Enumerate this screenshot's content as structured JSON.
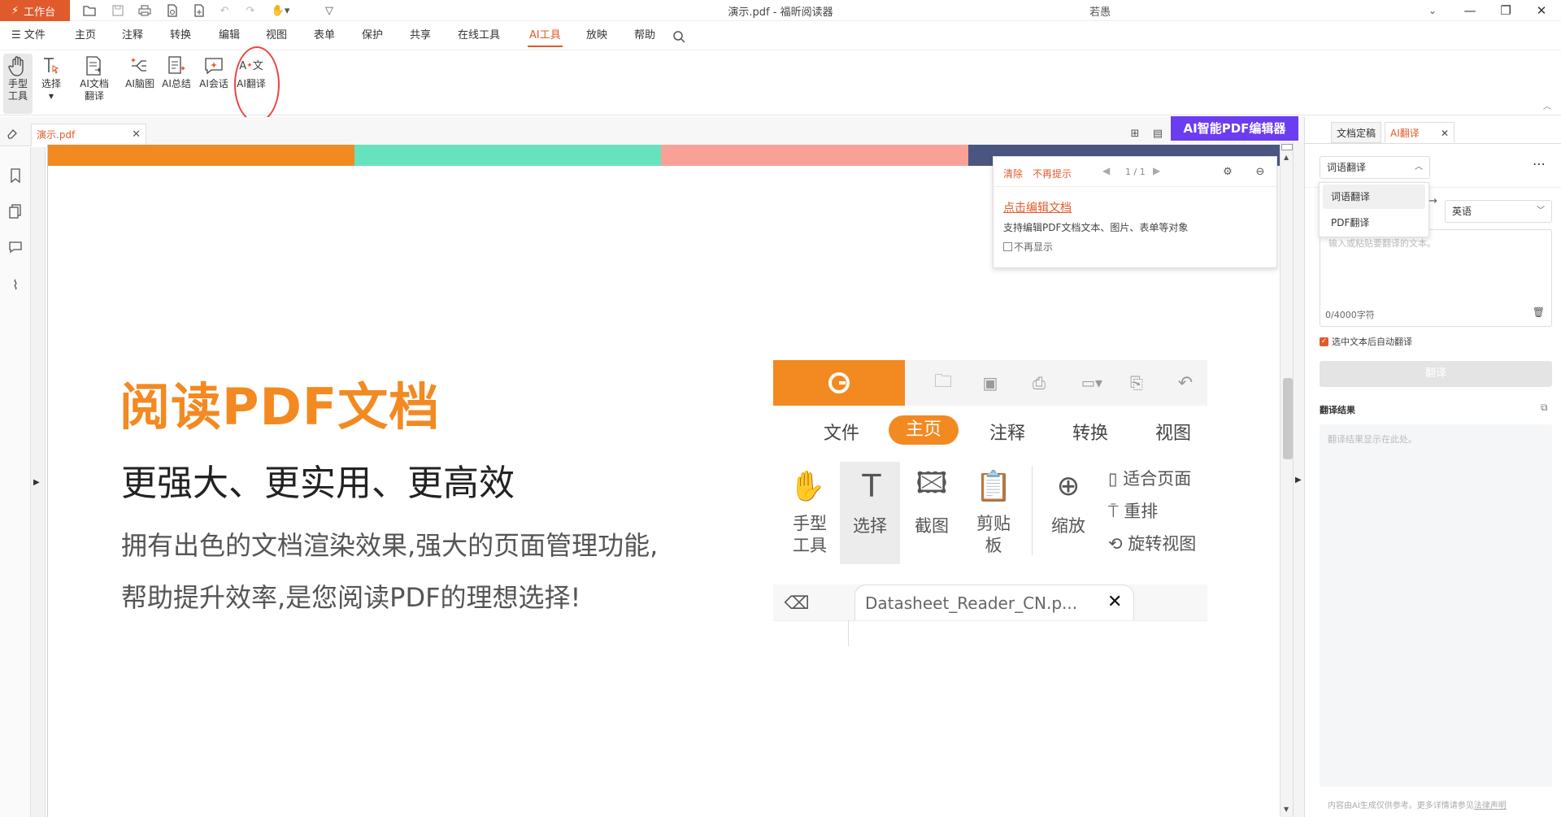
{
  "titlebar": {
    "workbench_label": "工作台",
    "title": "演示.pdf - 福昕阅读器",
    "user_name": "若愚"
  },
  "menu": {
    "file": "文件",
    "items": [
      "主页",
      "注释",
      "转换",
      "编辑",
      "视图",
      "表单",
      "保护",
      "共享",
      "在线工具",
      "AI工具",
      "放映",
      "帮助"
    ],
    "active": "AI工具"
  },
  "ribbon": {
    "hand": "手型\n工具",
    "select": "选择",
    "ai_doc_translate": "AI文档\n翻译",
    "ai_mindmap": "AI脑图",
    "ai_summary": "AI总结",
    "ai_chat": "AI会话",
    "ai_translate": "AI翻译"
  },
  "tabs": {
    "doc_tab": "演示.pdf",
    "ai_banner": "AI智能PDF编辑器"
  },
  "page": {
    "stripe_colors": [
      "#f28a21",
      "#67e2bf",
      "#f9a196",
      "#4a5580"
    ],
    "heading": "阅读PDF文档",
    "subheading": "更强大、更实用、更高效",
    "body_line1": "拥有出色的文档渲染效果,强大的页面管理功能,",
    "body_line2": "帮助提升效率,是您阅读PDF的理想选择!",
    "accent": "#f28a21"
  },
  "embedded_shot": {
    "menu": [
      "文件",
      "主页",
      "注释",
      "转换",
      "视图"
    ],
    "active_menu": "主页",
    "tools": {
      "hand": "手型\n工具",
      "select": "选择",
      "screenshot": "截图",
      "clipboard": "剪贴\n板",
      "zoom": "缩放",
      "fit_page": "适合页面",
      "reflow": "重排",
      "rotate_view": "旋转视图"
    },
    "tab_name": "Datasheet_Reader_CN.p..."
  },
  "popup": {
    "clear": "清除",
    "no_remind": "不再提示",
    "pager": "1 / 1",
    "link": "点击编辑文档",
    "desc": "支持编辑PDF文档文本、图片、表单等对象",
    "checkbox_label": "不再显示"
  },
  "right_panel": {
    "tab1": "文档定稿",
    "tab2": "AI翻译",
    "mode_select": "词语翻译",
    "dropdown_options": [
      "词语翻译",
      "PDF翻译"
    ],
    "target_lang": "英语",
    "input_placeholder": "输入或粘贴要翻译的文本。",
    "char_count": "0/4000字符",
    "auto_translate_label": "选中文本后自动翻译",
    "translate_button": "翻译",
    "result_title": "翻译结果",
    "result_placeholder": "翻译结果显示在此处。",
    "footer": "内容由AI生成仅供参考。更多详情请参见",
    "footer_link": "法律声明"
  }
}
